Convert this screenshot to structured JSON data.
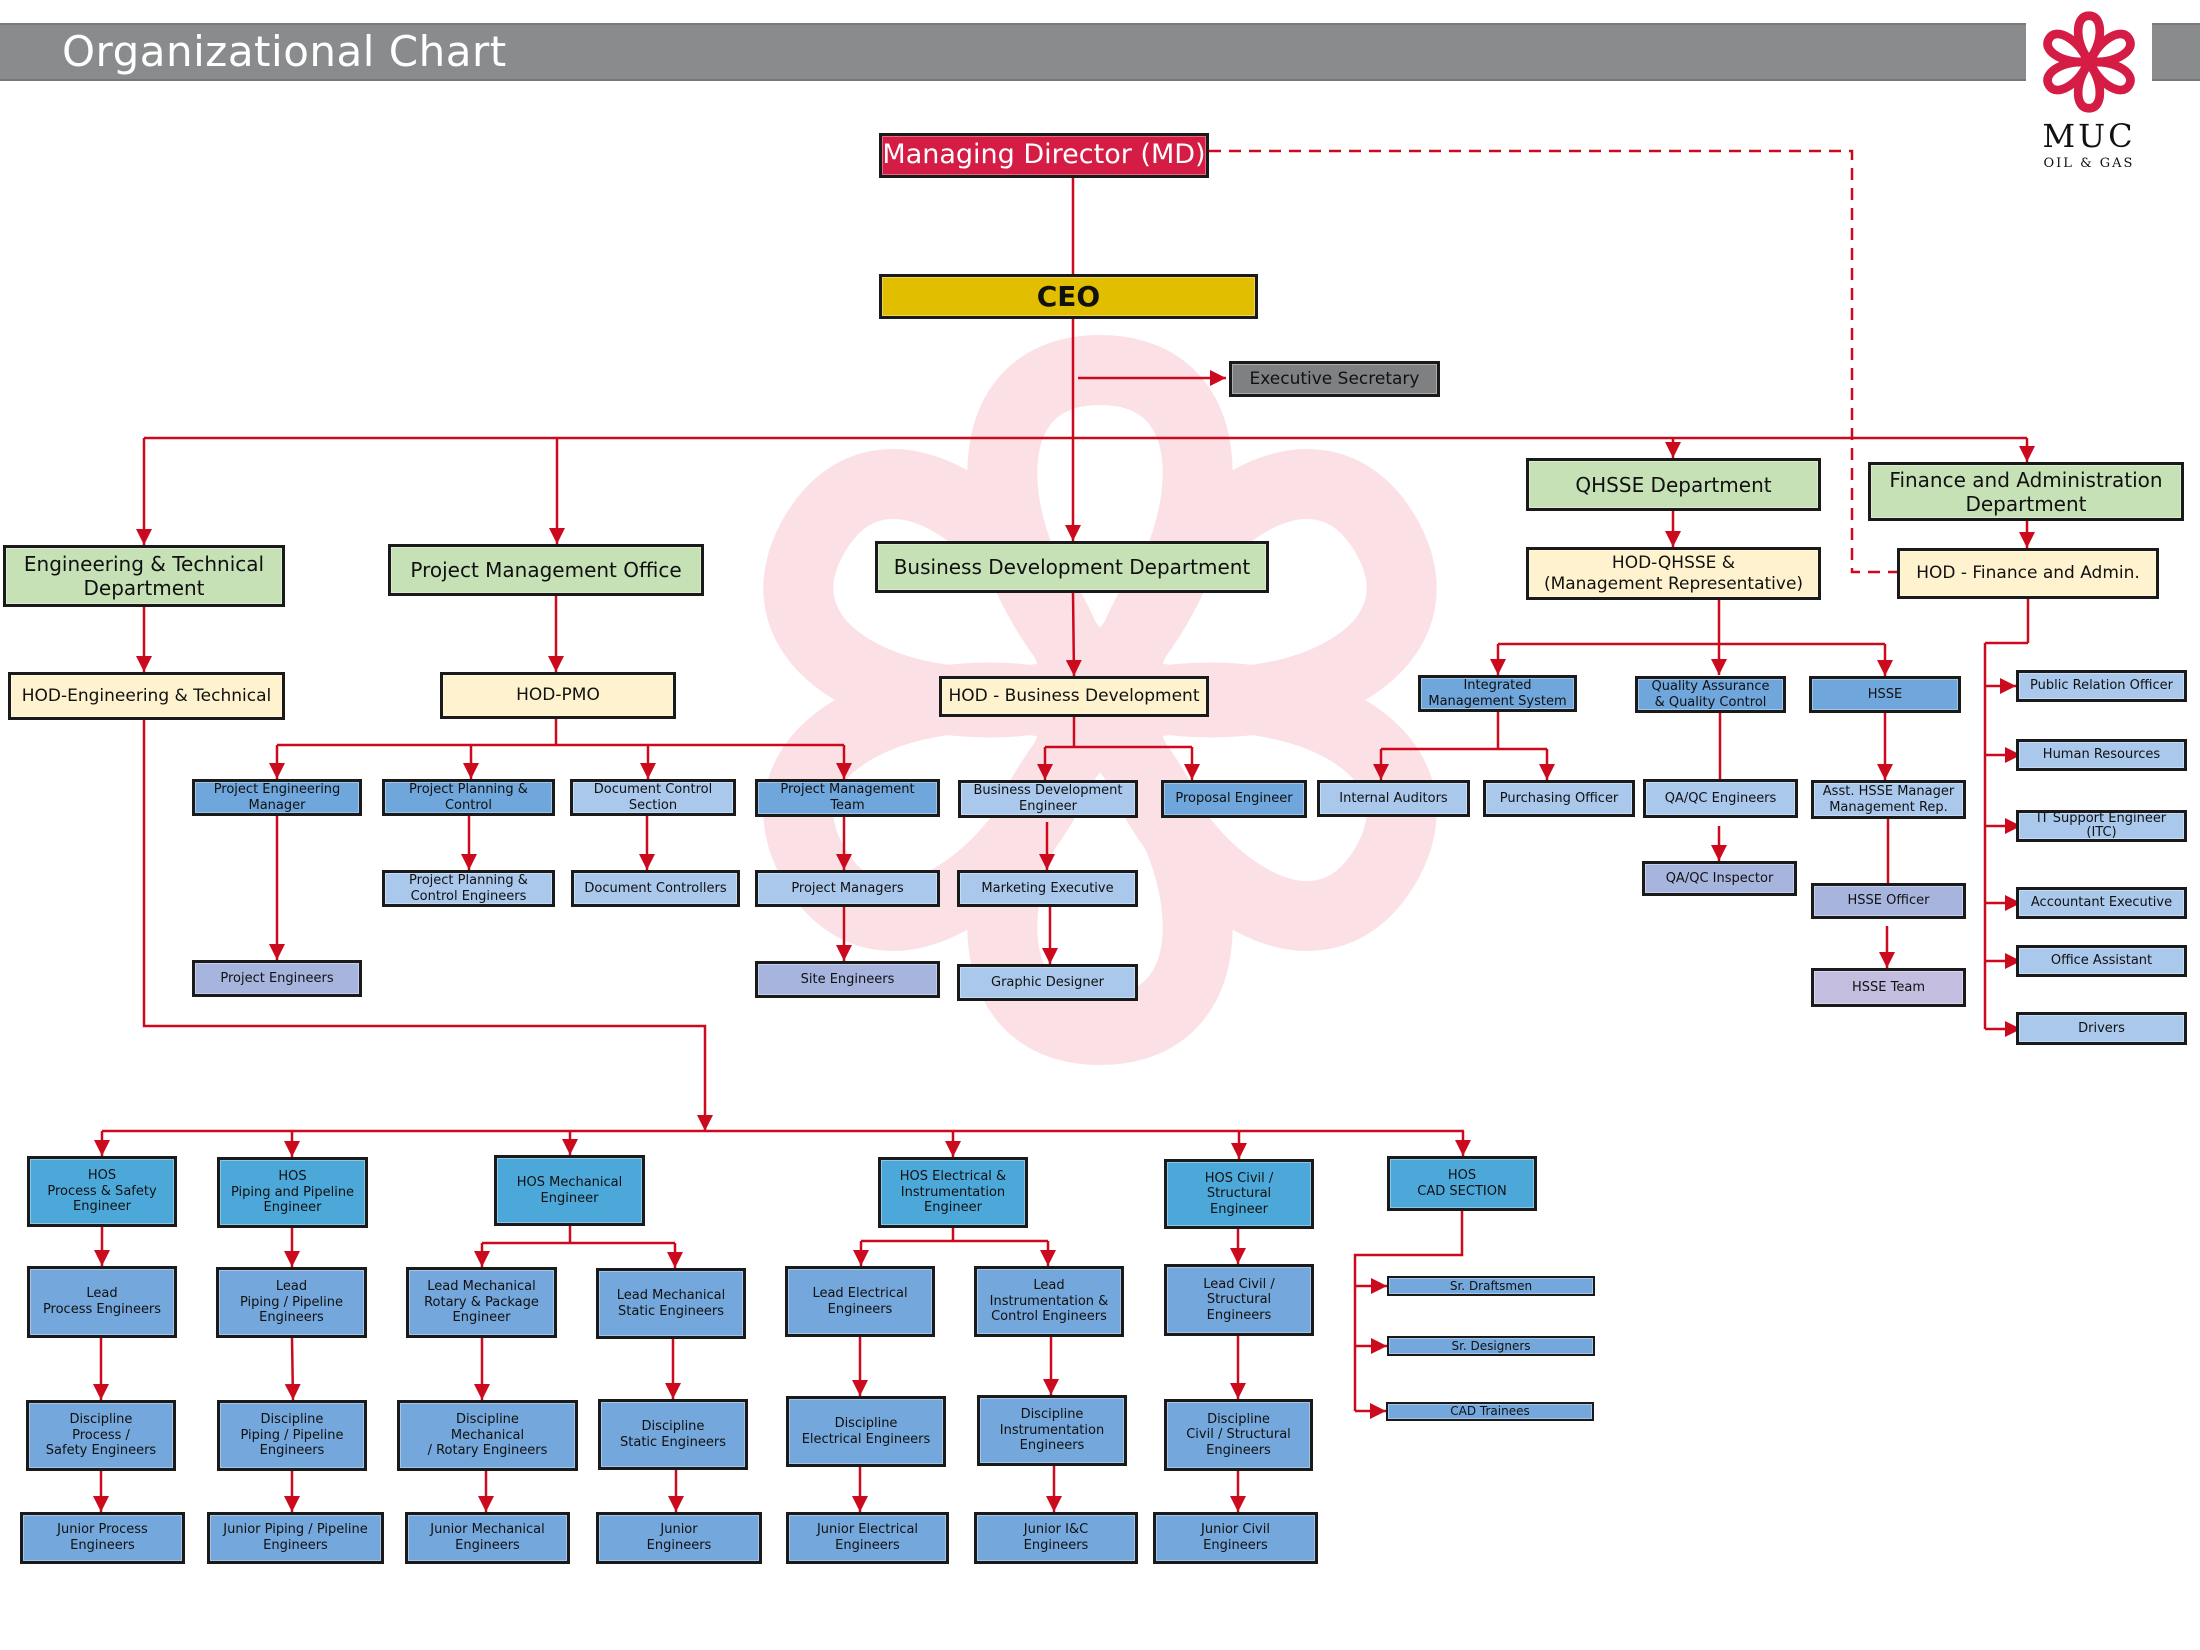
{
  "header": {
    "title": "Organizational Chart"
  },
  "logo": {
    "name": "MUC",
    "subtitle": "OIL & GAS",
    "icon": "flower-logo-icon",
    "brand_color": "#d41c44"
  },
  "colors": {
    "connector": "#cc0a1e",
    "md": "#d41c44",
    "ceo": "#e1bf00",
    "department": "#c7e1b6",
    "hod": "#fff2cf",
    "section": "#6fa6dc",
    "staff": "#a9c8ec",
    "hos": "#4da8da",
    "watermark": "#fbe3e7"
  },
  "executive": {
    "md": "Managing Director (MD)",
    "ceo": "CEO",
    "executive_secretary": "Executive Secretary"
  },
  "departments": {
    "engineering": {
      "name": "Engineering & Technical\nDepartment",
      "hod": "HOD-Engineering & Technical"
    },
    "pmo": {
      "name": "Project Management Office",
      "hod": "HOD-PMO"
    },
    "business_dev": {
      "name": "Business Development Department",
      "hod": "HOD - Business Development"
    },
    "qhsse": {
      "name": "QHSSE Department",
      "hod": "HOD-QHSSE &\n(Management Representative)"
    },
    "finance": {
      "name": "Finance and Administration\nDepartment",
      "hod": "HOD - Finance and Admin."
    }
  },
  "pmo_units": {
    "project_engineering_manager": "Project Engineering\nManager",
    "project_engineers": "Project Engineers",
    "project_planning_control": "Project Planning &\nControl",
    "project_planning_control_engineers": "Project Planning &\nControl Engineers",
    "document_control_section": "Document Control\nSection",
    "document_controllers": "Document Controllers",
    "project_management_team": "Project Management\nTeam",
    "project_managers": "Project Managers",
    "site_engineers": "Site Engineers"
  },
  "bd_units": {
    "business_development_engineer": "Business Development\nEngineer",
    "marketing_executive": "Marketing Executive",
    "graphic_designer": "Graphic Designer",
    "proposal_engineer": "Proposal Engineer"
  },
  "qhsse_units": {
    "ims": "Integrated\nManagement System",
    "internal_auditors": "Internal Auditors",
    "purchasing_officer": "Purchasing Officer",
    "qaqc": "Quality Assurance\n& Quality Control",
    "qaqc_engineers": "QA/QC Engineers",
    "qaqc_inspector": "QA/QC Inspector",
    "hsse": "HSSE",
    "asst_hsse_manager": "Asst. HSSE Manager\nManagement Rep.",
    "hsse_officer": "HSSE Officer",
    "hsse_team": "HSSE Team"
  },
  "finance_units": [
    "Public Relation Officer",
    "Human Resources",
    "IT Support Engineer\n(ITC)",
    "Accountant Executive",
    "Office Assistant",
    "Drivers"
  ],
  "engineering_sections": {
    "process": {
      "hos": "HOS\nProcess & Safety\nEngineer",
      "lead": "Lead\nProcess Engineers",
      "discipline": "Discipline\nProcess /\nSafety Engineers",
      "junior": "Junior Process\nEngineers"
    },
    "piping": {
      "hos": "HOS\nPiping and Pipeline\nEngineer",
      "lead": "Lead\nPiping / Pipeline\nEngineers",
      "discipline": "Discipline\nPiping / Pipeline\nEngineers",
      "junior": "Junior Piping / Pipeline\nEngineers"
    },
    "mechanical": {
      "hos": "HOS Mechanical\nEngineer",
      "lead_rotary": "Lead Mechanical\nRotary & Package\nEngineer",
      "lead_static": "Lead Mechanical\nStatic Engineers",
      "discipline_rotary": "Discipline\nMechanical\n/ Rotary  Engineers",
      "discipline_static": "Discipline\nStatic Engineers",
      "junior_mechanical": "Junior Mechanical\nEngineers",
      "junior_static": "Junior\nEngineers"
    },
    "electrical": {
      "hos": "HOS Electrical &\nInstrumentation\nEngineer",
      "lead_electrical": "Lead Electrical\nEngineers",
      "lead_instrumentation": "Lead\nInstrumentation &\nControl Engineers",
      "discipline_electrical": "Discipline\nElectrical Engineers",
      "discipline_instrumentation": "Discipline\nInstrumentation\nEngineers",
      "junior_electrical": "Junior Electrical\nEngineers",
      "junior_ic": "Junior I&C\nEngineers"
    },
    "civil": {
      "hos": "HOS Civil /\nStructural\nEngineer",
      "lead": "Lead Civil /\nStructural\nEngineers",
      "discipline": "Discipline\nCivil / Structural\nEngineers",
      "junior": "Junior Civil\nEngineers"
    },
    "cad": {
      "hos": "HOS\nCAD SECTION",
      "members": [
        "Sr. Draftsmen",
        "Sr. Designers",
        "CAD Trainees"
      ]
    }
  }
}
